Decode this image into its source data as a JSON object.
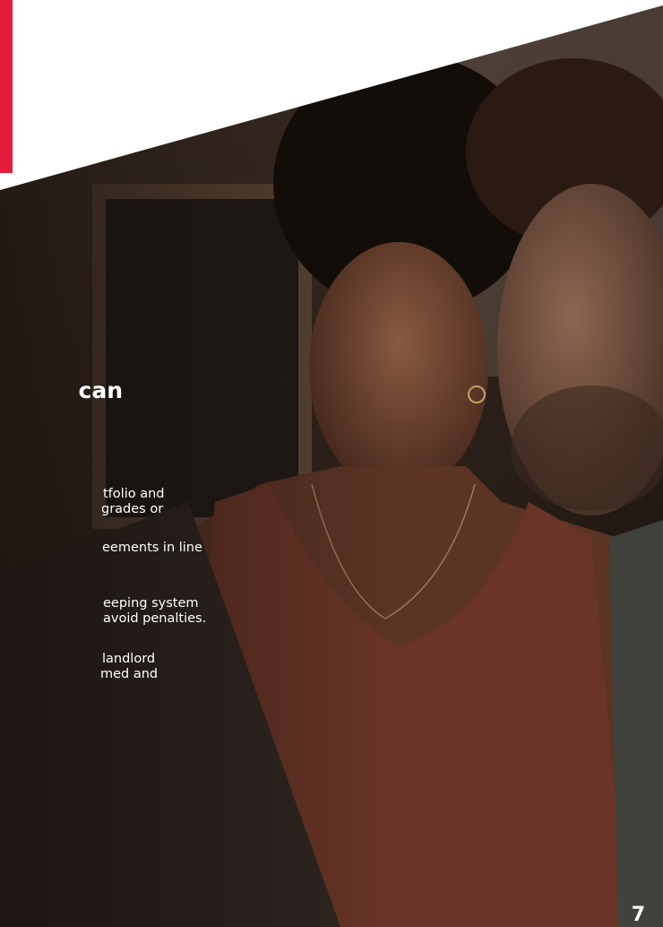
{
  "accent_color": "#e41b3a",
  "section": {
    "heading": "can",
    "paragraphs": [
      {
        "lines": [
          "tfolio and",
          "grades or"
        ]
      },
      {
        "lines": [
          "eements in line"
        ]
      },
      {
        "lines": [
          "eeping system",
          "avoid penalties."
        ]
      },
      {
        "lines": [
          "landlord",
          "med and"
        ]
      }
    ]
  },
  "page_number": "7"
}
